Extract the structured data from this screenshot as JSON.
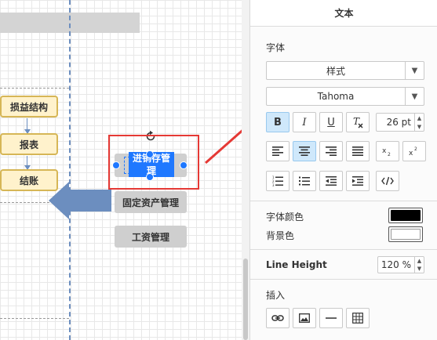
{
  "canvas": {
    "flow_items": [
      "损益结构",
      "报表",
      "结账"
    ],
    "selected_label": "进销存管理",
    "buttons": [
      "固定资产管理",
      "工资管理"
    ]
  },
  "panel": {
    "title": "文本",
    "font_section": "字体",
    "style_select": "样式",
    "font_select": "Tahoma",
    "font_size": "26 pt",
    "bold": "B",
    "italic": "I",
    "underline": "U",
    "font_color_label": "字体颜色",
    "bg_color_label": "背景色",
    "font_color": "#000000",
    "bg_color": "#ffffff",
    "line_height_label": "Line Height",
    "line_height_value": "120 %",
    "insert_label": "插入"
  },
  "colors": {
    "accent": "#1f78ff",
    "highlight": "#e53935",
    "flow_fill": "#fff2cc",
    "flow_border": "#d6b656",
    "lane": "#6c8ebf"
  }
}
